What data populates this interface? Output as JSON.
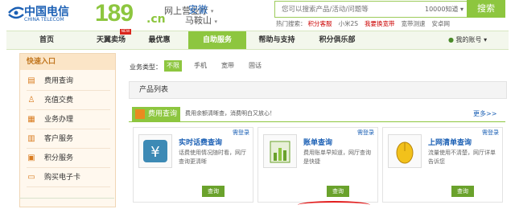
{
  "header": {
    "brand_cn": "中国电信",
    "brand_en": "CHINA TELECOM",
    "site_num": "189",
    "site_suffix": ".cn",
    "site_name": "网上营业厅",
    "province": "安徽",
    "city": "马鞍山"
  },
  "search": {
    "placeholder": "您可以搜索产品/活动/问题等",
    "scope": "10000知道",
    "button": "搜索",
    "hot_label": "热门搜索：",
    "hot_terms": [
      "积分客服",
      "小米2S",
      "我要换宽带",
      "宽带测速",
      "安卓网"
    ]
  },
  "nav": {
    "items": [
      "首页",
      "天翼卖场",
      "最优惠",
      "自助服务",
      "帮助与支持",
      "积分俱乐部"
    ],
    "new_badge": "NEW",
    "account": "我的账号"
  },
  "sidebar": {
    "title": "快速入口",
    "items": [
      "费用查询",
      "充值交费",
      "业务办理",
      "客户服务",
      "积分服务",
      "购买电子卡"
    ]
  },
  "filter": {
    "label": "业务类型：",
    "options": [
      "不限",
      "手机",
      "宽带",
      "固话"
    ]
  },
  "product_list": {
    "title": "产品列表"
  },
  "section": {
    "title": "费用查询",
    "desc": "费用余额清晰查，消费明白又放心！",
    "more": "更多>>"
  },
  "cards": [
    {
      "need_login": "需登录",
      "title": "实时话费查询",
      "desc": "话费使用情况随时看，网厅查询更清晰",
      "button": "查询"
    },
    {
      "need_login": "需登录",
      "title": "账单查询",
      "desc": "费用账单早知道，网厅查询是快捷",
      "button": "查询"
    },
    {
      "need_login": "需登录",
      "title": "上网清单查询",
      "desc": "流量使用不清楚，网厅详单告诉您",
      "button": "查询"
    }
  ],
  "colors": {
    "brand_green": "#8dc63f",
    "brand_blue": "#1a5fb4",
    "accent_orange": "#d97b1f"
  }
}
